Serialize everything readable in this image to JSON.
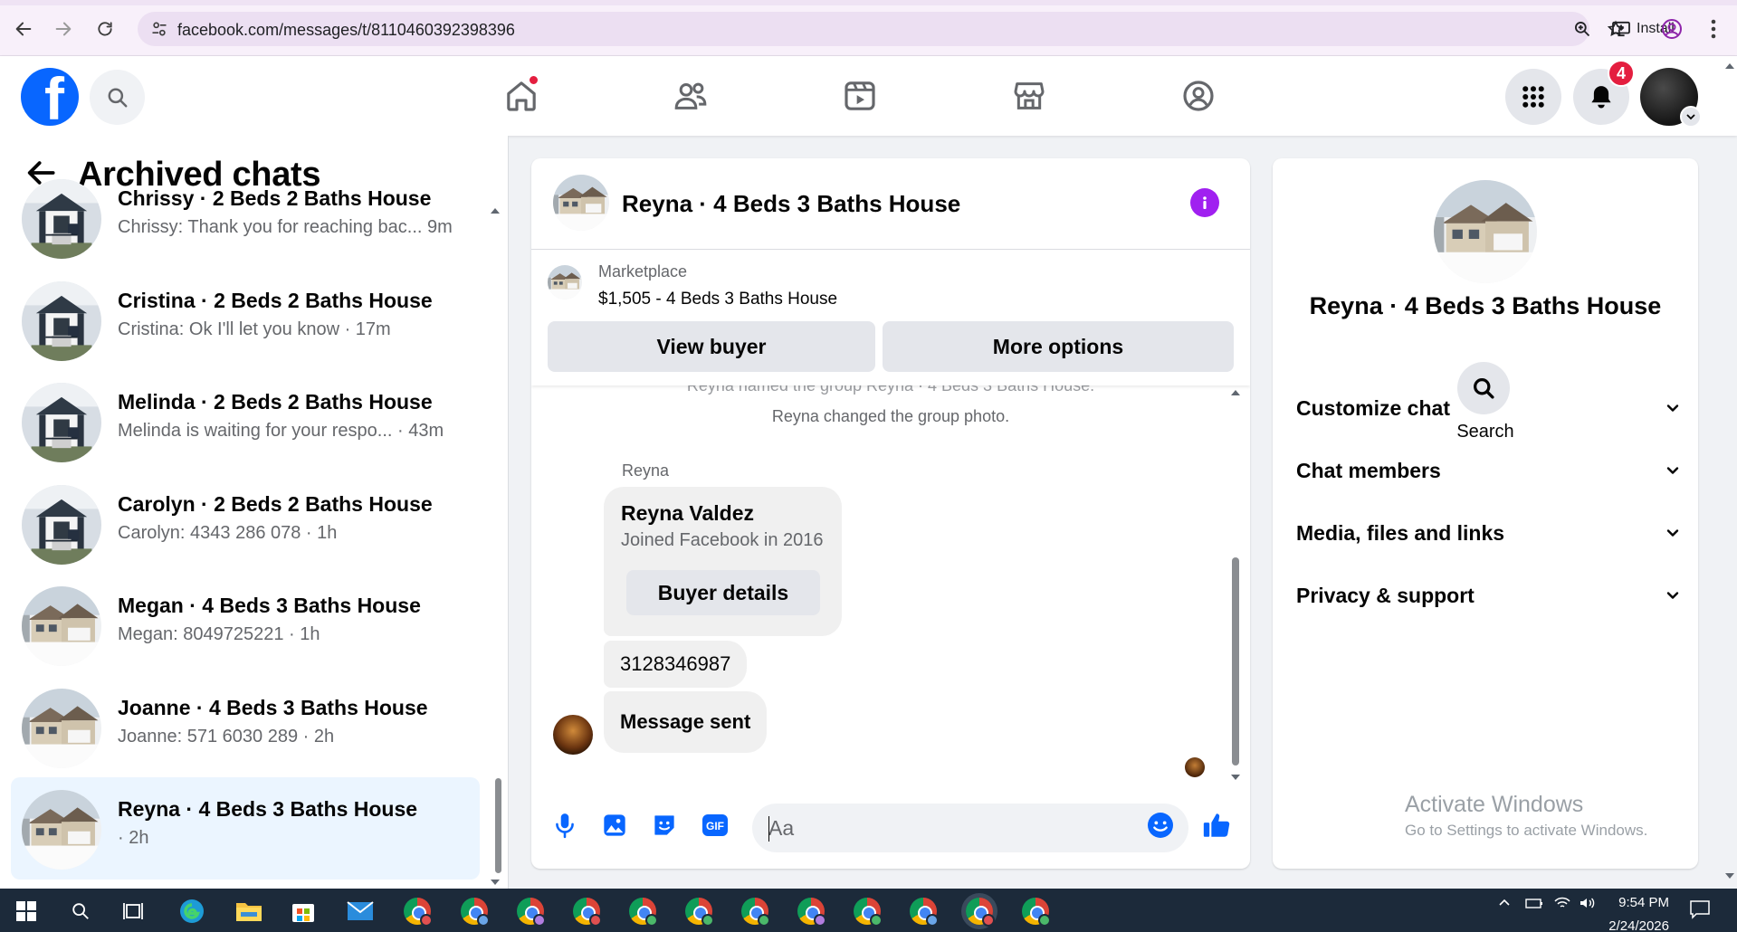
{
  "browser": {
    "url": "facebook.com/messages/t/8110460392398396",
    "install_label": "Install"
  },
  "header": {
    "notification_count": "4"
  },
  "sidebar": {
    "title": "Archived chats",
    "chats": [
      {
        "name": "Chrissy · 2 Beds 2 Baths House",
        "preview": "Chrissy: Thank you for reaching bac... 9m",
        "photo": "house-blue"
      },
      {
        "name": "Cristina · 2 Beds 2 Baths House",
        "preview": "Cristina: Ok I'll let you know · 17m",
        "photo": "house-blue"
      },
      {
        "name": "Melinda · 2 Beds 2 Baths House",
        "preview": "Melinda is waiting for your respo...  · 43m",
        "photo": "house-blue"
      },
      {
        "name": "Carolyn · 2 Beds 2 Baths House",
        "preview": "Carolyn: 4343 286 078 · 1h",
        "photo": "house-blue"
      },
      {
        "name": "Megan · 4 Beds 3 Baths House",
        "preview": "Megan: 8049725221 · 1h",
        "photo": "house-snow"
      },
      {
        "name": "Joanne · 4 Beds 3 Baths House",
        "preview": "Joanne: 571 6030 289 · 2h",
        "photo": "house-snow"
      },
      {
        "name": "Reyna · 4 Beds 3 Baths House",
        "preview": "· 2h",
        "photo": "house-snow",
        "selected": true
      }
    ]
  },
  "chat": {
    "title": "Reyna · 4 Beds 3 Baths House",
    "marketplace": {
      "label": "Marketplace",
      "item": "$1,505 - 4 Beds 3 Baths House",
      "view_buyer": "View buyer",
      "more_options": "More options"
    },
    "messages": {
      "system_partial": "Reyna named the group Reyna · 4 Beds 3 Baths House.",
      "system_photo": "Reyna changed the group photo.",
      "sender": "Reyna",
      "buyer_name": "Reyna Valdez",
      "buyer_joined": "Joined Facebook in 2016",
      "buyer_details": "Buyer details",
      "phone": "3128346987",
      "sent": "Message sent"
    },
    "composer_placeholder": "Aa"
  },
  "info": {
    "name": "Reyna · 4 Beds 3 Baths House",
    "search_label": "Search",
    "rows": [
      "Customize chat",
      "Chat members",
      "Media, files and links",
      "Privacy & support"
    ]
  },
  "watermark": {
    "line1": "Activate Windows",
    "line2": "Go to Settings to activate Windows."
  },
  "taskbar": {
    "time": "9:54 PM",
    "date": "2/24/2026"
  },
  "colors": {
    "fb_blue": "#0866ff",
    "notification_red": "#e41e3f",
    "info_purple": "#a020f0",
    "selected_chat": "#ebf5ff"
  }
}
